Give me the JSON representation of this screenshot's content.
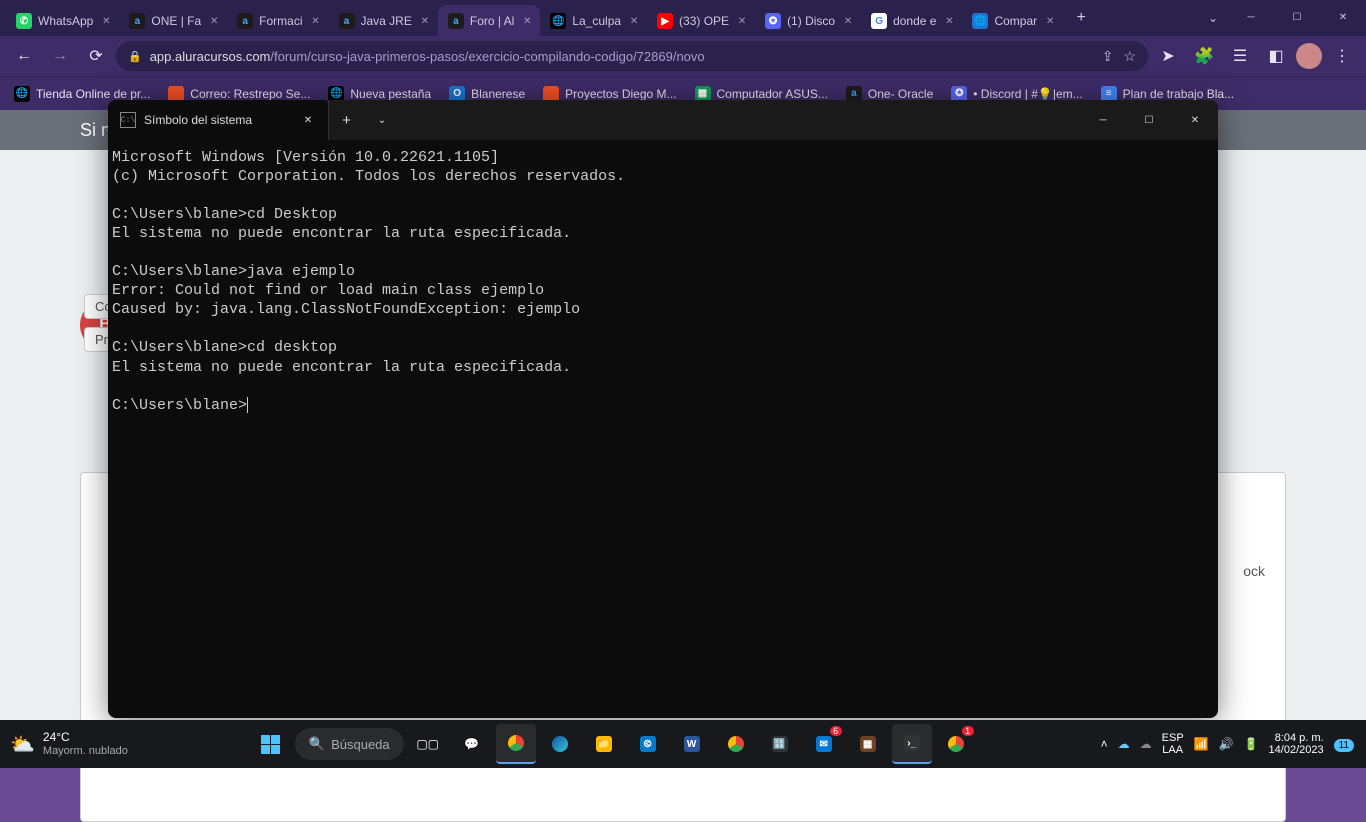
{
  "browser": {
    "tabs": [
      {
        "title": "WhatsApp",
        "favicon": "whatsapp"
      },
      {
        "title": "ONE | Fa",
        "favicon": "alura"
      },
      {
        "title": "Formaci",
        "favicon": "alura"
      },
      {
        "title": "Java JRE",
        "favicon": "alura"
      },
      {
        "title": "Foro | Al",
        "favicon": "alura",
        "active": true
      },
      {
        "title": "La_culpa",
        "favicon": "globe"
      },
      {
        "title": "(33) OPE",
        "favicon": "youtube"
      },
      {
        "title": "(1) Disco",
        "favicon": "discord"
      },
      {
        "title": "donde e",
        "favicon": "google"
      },
      {
        "title": "Compar",
        "favicon": "globe-blue"
      }
    ],
    "address": {
      "host": "app.aluracursos.com",
      "path": "/forum/curso-java-primeros-pasos/exercicio-compilando-codigo/72869/novo"
    },
    "bookmarks": [
      {
        "label": "Tienda Online de pr...",
        "icon": "globe"
      },
      {
        "label": "Correo: Restrepo Se...",
        "icon": "grid"
      },
      {
        "label": "Nueva pestaña",
        "icon": "globe"
      },
      {
        "label": "Blanerese",
        "icon": "o-blue"
      },
      {
        "label": "Proyectos Diego M...",
        "icon": "grid"
      },
      {
        "label": "Computador ASUS...",
        "icon": "sheet"
      },
      {
        "label": "One- Oracle",
        "icon": "alura"
      },
      {
        "label": "• Discord | #💡|em...",
        "icon": "discord"
      },
      {
        "label": "Plan de trabajo Bla...",
        "icon": "doc"
      }
    ]
  },
  "page": {
    "heading_fragment": "Si n",
    "pill1": "Con",
    "pill2": "Pr",
    "blocktext": "ock"
  },
  "terminal": {
    "tab_title": "Símbolo del sistema",
    "lines": [
      "Microsoft Windows [Versión 10.0.22621.1105]",
      "(c) Microsoft Corporation. Todos los derechos reservados.",
      "",
      "C:\\Users\\blane>cd Desktop",
      "El sistema no puede encontrar la ruta especificada.",
      "",
      "C:\\Users\\blane>java ejemplo",
      "Error: Could not find or load main class ejemplo",
      "Caused by: java.lang.ClassNotFoundException: ejemplo",
      "",
      "C:\\Users\\blane>cd desktop",
      "El sistema no puede encontrar la ruta especificada.",
      "",
      "C:\\Users\\blane>"
    ]
  },
  "taskbar": {
    "weather_temp": "24°C",
    "weather_desc": "Mayorm. nublado",
    "search_label": "Búsqueda",
    "lang": "ESP",
    "kb": "LAA",
    "time": "8:04 p. m.",
    "date": "14/02/2023",
    "notif_count": "11"
  }
}
